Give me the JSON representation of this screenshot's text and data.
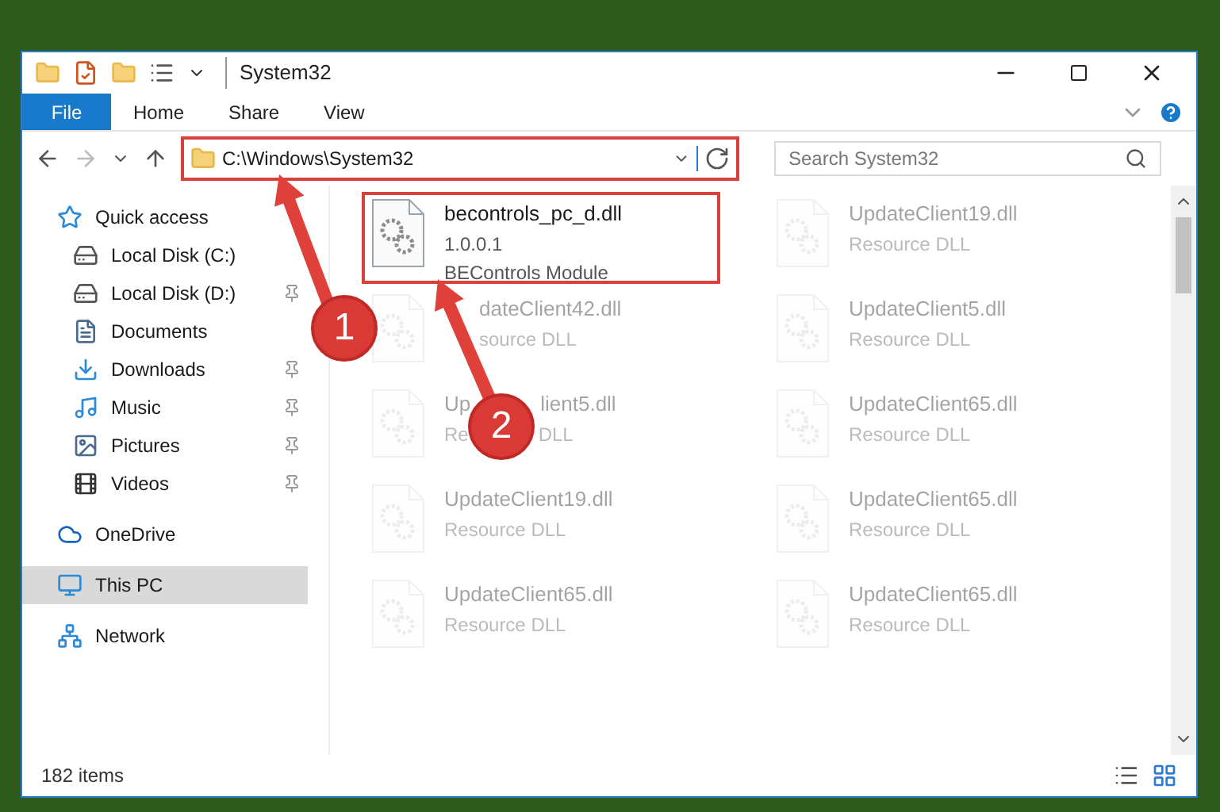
{
  "window": {
    "title": "System32"
  },
  "ribbon_tabs": [
    {
      "label": "File",
      "kind": "file",
      "selected": false
    },
    {
      "label": "Home",
      "kind": "tab",
      "selected": false
    },
    {
      "label": "Share",
      "kind": "tab",
      "selected": false
    },
    {
      "label": "View",
      "kind": "tab",
      "selected": false
    }
  ],
  "address_bar": {
    "path": "C:\\Windows\\System32",
    "highlighted": true
  },
  "search": {
    "placeholder": "Search System32"
  },
  "sidebar": {
    "items": [
      {
        "label": "Quick access",
        "kind": "quick",
        "selected": false,
        "children": [
          {
            "label": "Local Disk (C:)",
            "kind": "diskc",
            "pinned": false,
            "selected": false
          },
          {
            "label": "Local Disk (D:)",
            "kind": "disk",
            "pinned": true,
            "selected": false
          },
          {
            "label": "Documents",
            "kind": "documents",
            "pinned": false,
            "selected": false
          },
          {
            "label": "Downloads",
            "kind": "downloads",
            "pinned": true,
            "selected": false
          },
          {
            "label": "Music",
            "kind": "music",
            "pinned": true,
            "selected": false
          },
          {
            "label": "Pictures",
            "kind": "pictures",
            "pinned": true,
            "selected": false
          },
          {
            "label": "Videos",
            "kind": "videos",
            "pinned": true,
            "selected": false
          }
        ]
      },
      {
        "label": "OneDrive",
        "kind": "cloud",
        "selected": false
      },
      {
        "label": "This PC",
        "kind": "pc",
        "selected": true
      },
      {
        "label": "Network",
        "kind": "network",
        "selected": false
      }
    ]
  },
  "files": [
    {
      "name": [
        "becontrols_pc_d.dll"
      ],
      "details": [
        [
          "1.0.0.1"
        ],
        [
          "BEControls Module"
        ]
      ],
      "highlighted": true,
      "faded": false
    },
    {
      "name": [
        "UpdateClient19.dll"
      ],
      "details": [
        [
          "Resource DLL"
        ]
      ],
      "highlighted": false,
      "faded": true
    },
    {
      "name": [
        "dateClient42.dll"
      ],
      "details": [
        [
          "source DLL"
        ]
      ],
      "highlighted": false,
      "faded": true
    },
    {
      "name": [
        "UpdateClient5.dll"
      ],
      "details": [
        [
          "Resource DLL"
        ]
      ],
      "highlighted": false,
      "faded": true
    },
    {
      "name": [
        "Up",
        "lient5.dll"
      ],
      "details": [
        [
          "Re",
          "DLL"
        ]
      ],
      "highlighted": false,
      "faded": true
    },
    {
      "name": [
        "UpdateClient65.dll"
      ],
      "details": [
        [
          "Resource DLL"
        ]
      ],
      "highlighted": false,
      "faded": true
    },
    {
      "name": [
        "UpdateClient19.dll"
      ],
      "details": [
        [
          "Resource DLL"
        ]
      ],
      "highlighted": false,
      "faded": true
    },
    {
      "name": [
        "UpdateClient65.dll"
      ],
      "details": [
        [
          "Resource DLL"
        ]
      ],
      "highlighted": false,
      "faded": true
    },
    {
      "name": [
        "UpdateClient65.dll"
      ],
      "details": [
        [
          "Resource DLL"
        ]
      ],
      "highlighted": false,
      "faded": true
    },
    {
      "name": [
        "UpdateClient65.dll"
      ],
      "details": [
        [
          "Resource DLL"
        ]
      ],
      "highlighted": false,
      "faded": true
    }
  ],
  "status_bar": {
    "count": "182 items"
  },
  "annotations": [
    {
      "number": "1"
    },
    {
      "number": "2"
    }
  ]
}
